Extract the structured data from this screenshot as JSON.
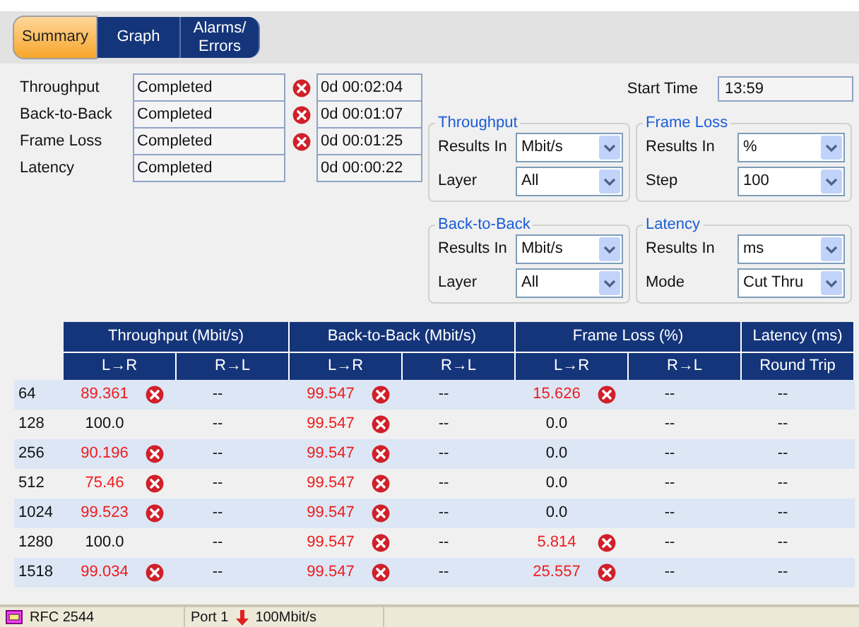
{
  "tabs": [
    {
      "label": "Summary",
      "selected": true
    },
    {
      "label": "Graph",
      "selected": false
    },
    {
      "label": "Alarms/\nErrors",
      "selected": false
    }
  ],
  "tests": [
    {
      "name": "Throughput",
      "status": "Completed",
      "failed": true,
      "duration": "0d 00:02:04"
    },
    {
      "name": "Back-to-Back",
      "status": "Completed",
      "failed": true,
      "duration": "0d 00:01:07"
    },
    {
      "name": "Frame Loss",
      "status": "Completed",
      "failed": true,
      "duration": "0d 00:01:25"
    },
    {
      "name": "Latency",
      "status": "Completed",
      "failed": false,
      "duration": "0d 00:00:22"
    }
  ],
  "start_time": {
    "label": "Start Time",
    "value": "13:59"
  },
  "settings": [
    {
      "title": "Throughput",
      "fields": [
        {
          "label": "Results In",
          "value": "Mbit/s"
        },
        {
          "label": "Layer",
          "value": "All"
        }
      ]
    },
    {
      "title": "Frame Loss",
      "fields": [
        {
          "label": "Results In",
          "value": "%"
        },
        {
          "label": "Step",
          "value": "100"
        }
      ]
    },
    {
      "title": "Back-to-Back",
      "fields": [
        {
          "label": "Results In",
          "value": "Mbit/s"
        },
        {
          "label": "Layer",
          "value": "All"
        }
      ]
    },
    {
      "title": "Latency",
      "fields": [
        {
          "label": "Results In",
          "value": "ms"
        },
        {
          "label": "Mode",
          "value": "Cut Thru"
        }
      ]
    }
  ],
  "table": {
    "groups": [
      {
        "label": "Throughput (Mbit/s)",
        "columns": [
          "L→R",
          "R→L"
        ]
      },
      {
        "label": "Back-to-Back (Mbit/s)",
        "columns": [
          "L→R",
          "R→L"
        ]
      },
      {
        "label": "Frame Loss (%)",
        "columns": [
          "L→R",
          "R→L"
        ]
      },
      {
        "label": "Latency (ms)",
        "columns": [
          "Round Trip"
        ]
      }
    ],
    "rows": [
      {
        "size": "64",
        "cells": [
          {
            "value": "89.361",
            "failed": true
          },
          {
            "value": "--",
            "failed": false
          },
          {
            "value": "99.547",
            "failed": true
          },
          {
            "value": "--",
            "failed": false
          },
          {
            "value": "15.626",
            "failed": true
          },
          {
            "value": "--",
            "failed": false
          },
          {
            "value": "--",
            "failed": false
          }
        ]
      },
      {
        "size": "128",
        "cells": [
          {
            "value": "100.0",
            "failed": false
          },
          {
            "value": "--",
            "failed": false
          },
          {
            "value": "99.547",
            "failed": true
          },
          {
            "value": "--",
            "failed": false
          },
          {
            "value": "0.0",
            "failed": false
          },
          {
            "value": "--",
            "failed": false
          },
          {
            "value": "--",
            "failed": false
          }
        ]
      },
      {
        "size": "256",
        "cells": [
          {
            "value": "90.196",
            "failed": true
          },
          {
            "value": "--",
            "failed": false
          },
          {
            "value": "99.547",
            "failed": true
          },
          {
            "value": "--",
            "failed": false
          },
          {
            "value": "0.0",
            "failed": false
          },
          {
            "value": "--",
            "failed": false
          },
          {
            "value": "--",
            "failed": false
          }
        ]
      },
      {
        "size": "512",
        "cells": [
          {
            "value": "75.46",
            "failed": true
          },
          {
            "value": "--",
            "failed": false
          },
          {
            "value": "99.547",
            "failed": true
          },
          {
            "value": "--",
            "failed": false
          },
          {
            "value": "0.0",
            "failed": false
          },
          {
            "value": "--",
            "failed": false
          },
          {
            "value": "--",
            "failed": false
          }
        ]
      },
      {
        "size": "1024",
        "cells": [
          {
            "value": "99.523",
            "failed": true
          },
          {
            "value": "--",
            "failed": false
          },
          {
            "value": "99.547",
            "failed": true
          },
          {
            "value": "--",
            "failed": false
          },
          {
            "value": "0.0",
            "failed": false
          },
          {
            "value": "--",
            "failed": false
          },
          {
            "value": "--",
            "failed": false
          }
        ]
      },
      {
        "size": "1280",
        "cells": [
          {
            "value": "100.0",
            "failed": false
          },
          {
            "value": "--",
            "failed": false
          },
          {
            "value": "99.547",
            "failed": true
          },
          {
            "value": "--",
            "failed": false
          },
          {
            "value": "5.814",
            "failed": true
          },
          {
            "value": "--",
            "failed": false
          },
          {
            "value": "--",
            "failed": false
          }
        ]
      },
      {
        "size": "1518",
        "cells": [
          {
            "value": "99.034",
            "failed": true
          },
          {
            "value": "--",
            "failed": false
          },
          {
            "value": "99.547",
            "failed": true
          },
          {
            "value": "--",
            "failed": false
          },
          {
            "value": "25.557",
            "failed": true
          },
          {
            "value": "--",
            "failed": false
          },
          {
            "value": "--",
            "failed": false
          }
        ]
      }
    ]
  },
  "status_bar": {
    "test": "RFC 2544",
    "port": "Port 1",
    "rate": "100Mbit/s"
  }
}
